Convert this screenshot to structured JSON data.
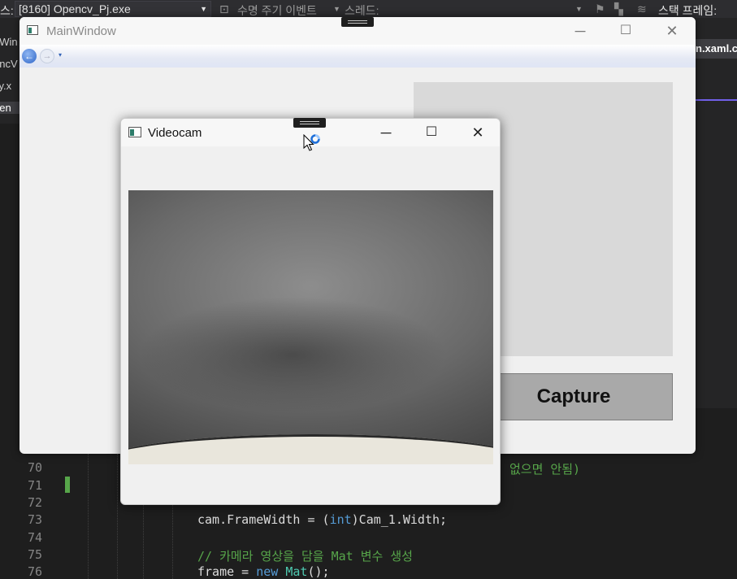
{
  "vs_toolbar": {
    "process_prefix": "스:",
    "process_value": "[8160] Opencv_Pj.exe",
    "lifecycle_label": "수명 주기 이벤트",
    "thread_label": "스레드:",
    "stackframe_label": "스택 프레임:"
  },
  "vs_side_tabs": [
    "nWin",
    "encV",
    "ify.x",
    "pen"
  ],
  "vs_right": {
    "tab_label": "n.xaml.c"
  },
  "main_window": {
    "title": "MainWindow",
    "minimize_glyph": "─",
    "maximize_glyph": "☐",
    "close_glyph": "✕",
    "back_glyph": "←",
    "forward_glyph": "→",
    "nav_dropdown_glyph": "▾",
    "capture_label": "Capture"
  },
  "videocam_window": {
    "title": "Videocam",
    "minimize_glyph": "─",
    "maximize_glyph": "☐",
    "close_glyph": "✕"
  },
  "editor": {
    "line_numbers": [
      "70",
      "71",
      "72",
      "73",
      "74",
      "75",
      "76"
    ],
    "lines": {
      "l70_tail": "없으면 안됨)",
      "l73_a": "cam.FrameWidth = (",
      "l73_kw": "int",
      "l73_b": ")Cam_1.Width;",
      "l75": "// 카메라 영상을 담을 Mat 변수 생성",
      "l76_a": "frame = ",
      "l76_kw": "new",
      "l76_sp": " ",
      "l76_type": "Mat",
      "l76_b": "();"
    }
  },
  "icons": {
    "app": "wpf-window-icon",
    "cursor": "busy-cursor-icon"
  },
  "colors": {
    "vs_background": "#1e1e1e",
    "comment": "#57a64a",
    "keyword": "#569cd6",
    "type": "#4ec9b0",
    "capture_button": "#a9a9a9",
    "preview_panel": "#d9d9d9"
  }
}
